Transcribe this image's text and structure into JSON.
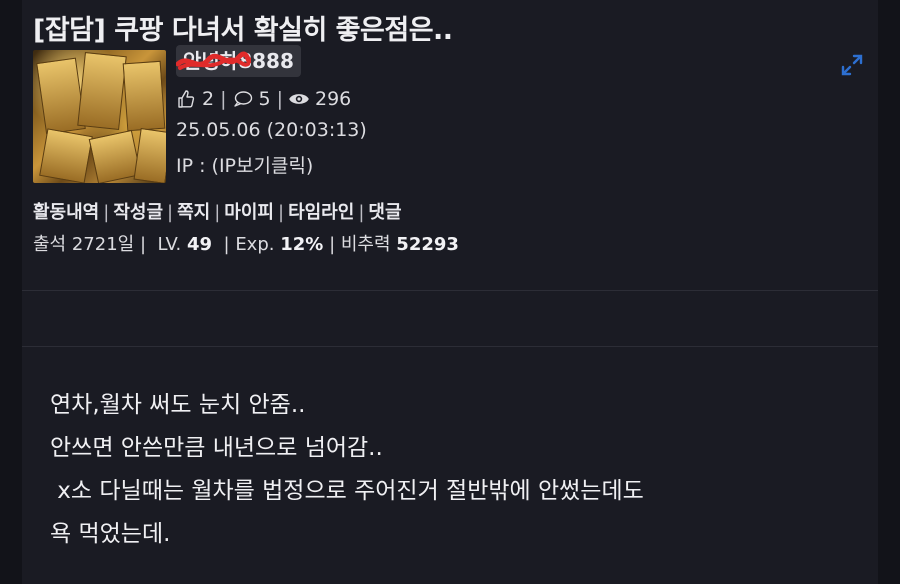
{
  "post": {
    "title": "[잡담] 쿠팡 다녀서 확실히 좋은점은..",
    "author_nick": "안녕하8888",
    "likes": "2",
    "comments": "5",
    "views": "296",
    "datetime": "25.05.06 (20:03:13)",
    "ip_label": "IP : (IP보기클릭)"
  },
  "links": [
    "활동내역",
    "작성글",
    "쪽지",
    "마이피",
    "타임라인",
    "댓글"
  ],
  "user_info": {
    "attendance_label": "출석 2721일",
    "lv_label": "LV.",
    "lv_value": "49",
    "exp_label": "Exp.",
    "exp_value": "12%",
    "fly_label": "비추력",
    "fly_value": "52293"
  },
  "content": {
    "lines": [
      "연차,월차 써도 눈치 안줌..",
      "안쓰면 안쓴만큼 내년으로 넘어감..",
      " x소 다닐때는 월차를 법정으로 주어진거 절반밖에 안썼는데도",
      "욕 먹었는데."
    ]
  },
  "icons": {
    "like": "thumbs-up-icon",
    "comment": "comment-icon",
    "view": "eye-icon",
    "expand": "expand-icon"
  },
  "colors": {
    "background": "#121319",
    "panel": "#1a1b23",
    "accent": "#2d6fd0",
    "scribble": "#e02b2b"
  }
}
